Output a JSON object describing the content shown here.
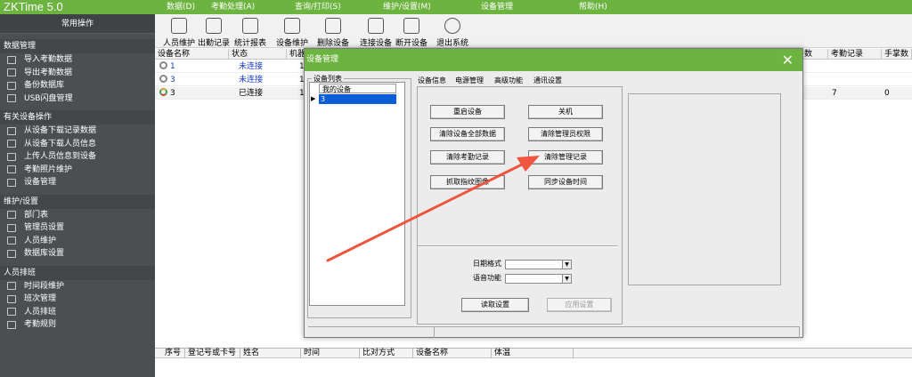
{
  "app": {
    "logo": "ZKTime 5.0"
  },
  "menu": [
    "数据(D)",
    "考勤处理(A)",
    "查询/打印(S)",
    "维护/设置(M)",
    "设备管理",
    "帮助(H)"
  ],
  "sidebar": {
    "header": "常用操作",
    "sections": [
      {
        "title": "数据管理",
        "items": [
          "导入考勤数据",
          "导出考勤数据",
          "备份数据库",
          "USB闪盘管理"
        ]
      },
      {
        "title": "有关设备操作",
        "items": [
          "从设备下载记录数据",
          "从设备下载人员信息",
          "上传人员信息到设备",
          "考勤照片维护",
          "设备管理"
        ]
      },
      {
        "title": "维护/设置",
        "items": [
          "部门表",
          "管理员设置",
          "人员维护",
          "数据库设置"
        ]
      },
      {
        "title": "人员排班",
        "items": [
          "时间段维护",
          "班次管理",
          "人员排班",
          "考勤规则"
        ]
      }
    ]
  },
  "toolbar": {
    "buttons": [
      "人员维护",
      "出勤记录",
      "统计报表",
      "设备维护",
      "删除设备",
      "连接设备",
      "断开设备",
      "退出系统"
    ]
  },
  "device_table": {
    "columns": [
      "设备名称",
      "状态",
      "机器",
      "数",
      "考勤记录",
      "手掌数"
    ],
    "rows": [
      {
        "name": "1",
        "status": "未连接",
        "machine": "1",
        "count": "",
        "records": "",
        "palm": ""
      },
      {
        "name": "3",
        "status": "未连接",
        "machine": "1",
        "count": "",
        "records": "",
        "palm": ""
      },
      {
        "name": "3",
        "status": "已连接",
        "machine": "1",
        "count": "",
        "records": "7",
        "palm": "0"
      }
    ]
  },
  "log_table": {
    "columns": [
      "序号",
      "登记号或卡号",
      "姓名",
      "时间",
      "比对方式",
      "设备名称",
      "体温"
    ]
  },
  "dialog": {
    "title": "设备管理",
    "device_list_label": "设备列表",
    "list_header": "我的设备",
    "list_rows": [
      "3"
    ],
    "tabs": [
      "设备信息",
      "电源管理",
      "高级功能",
      "通讯设置"
    ],
    "active_tab": "高级功能",
    "buttons": {
      "restart": "重启设备",
      "shutdown": "关机",
      "clear_all": "清除设备全部数据",
      "clear_admin": "清除管理员权限",
      "clear_att": "清除考勤记录",
      "clear_mgmt": "清除管理记录",
      "fetch_fp": "抓取指纹图像",
      "sync_time": "同步设备时间",
      "read": "读取设置",
      "apply": "应用设置"
    },
    "date_format_label": "日期格式",
    "voice_label": "语音功能",
    "date_format_value": "",
    "voice_value": ""
  },
  "colors": {
    "brand_green": "#6cb33f",
    "sidebar": "#4b4f52",
    "selected_blue": "#0b5ed7",
    "arrow_red": "#f0553f"
  }
}
